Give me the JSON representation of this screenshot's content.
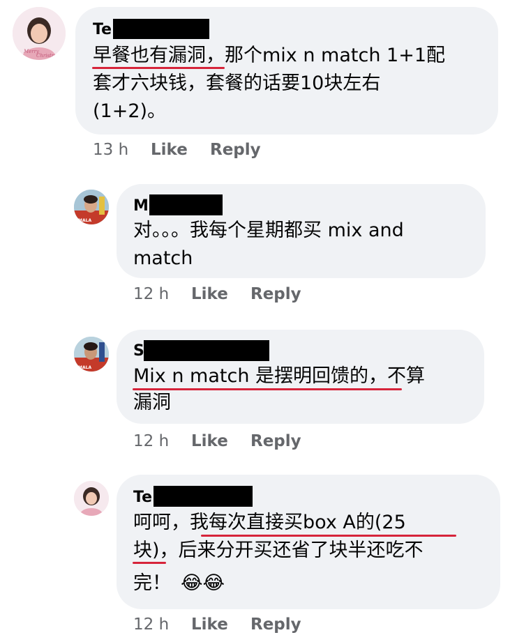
{
  "comments": [
    {
      "author_visible": "Te",
      "lines": [
        "早餐也有漏洞，那个mix n match 1+1配",
        "套才六块钱，套餐的话要10块左右",
        "(1+2)。"
      ],
      "time": "13 h",
      "like": "Like",
      "reply": "Reply"
    },
    {
      "author_visible": "M",
      "lines": [
        "对。。。我每个星期都买 mix and",
        "match"
      ],
      "time": "12 h",
      "like": "Like",
      "reply": "Reply"
    },
    {
      "author_visible": "S",
      "lines": [
        "Mix n match 是摆明回馈的，不算",
        "漏洞"
      ],
      "time": "12 h",
      "like": "Like",
      "reply": "Reply"
    },
    {
      "author_visible": "Te",
      "lines": [
        "呵呵，我每次直接买box A的(25",
        "块)，后来分开买还省了块半还吃不",
        "完！"
      ],
      "emoji": "😂😂",
      "time": "12 h",
      "like": "Like",
      "reply": "Reply"
    }
  ],
  "colors": {
    "bubble": "#f0f2f5",
    "underline": "#d6243a",
    "meta": "#65676b"
  }
}
